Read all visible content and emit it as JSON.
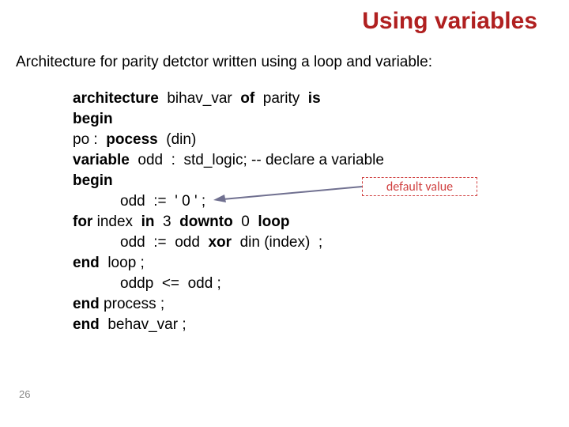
{
  "title": "Using variables",
  "subtitle": "Architecture for parity detctor written using a loop and variable:",
  "code": {
    "l1_a": "architecture",
    "l1_b": "  bihav_var  ",
    "l1_c": "of",
    "l1_d": "  parity  ",
    "l1_e": "is",
    "l2": "begin",
    "l3_a": "po :  ",
    "l3_b": "pocess",
    "l3_c": "  (din)",
    "l4_a": "variable",
    "l4_b": "  odd  :  std_logic; -- declare a variable",
    "l5": "begin",
    "l6": "odd  :=  ' 0 ' ;",
    "l7_a": "for",
    "l7_b": " index  ",
    "l7_c": "in",
    "l7_d": "  3  ",
    "l7_e": "downto",
    "l7_f": "  0  ",
    "l7_g": "loop",
    "l8_a": "odd  :=  odd  ",
    "l8_b": "xor",
    "l8_c": "  din (index)  ;",
    "l9_a": "end",
    "l9_b": "  loop ;",
    "l10": "oddp  <=  odd ;",
    "l11_a": "end",
    "l11_b": " process ;",
    "l12_a": "end",
    "l12_b": "  behav_var ;"
  },
  "callout": "default value",
  "slide_number": "26"
}
